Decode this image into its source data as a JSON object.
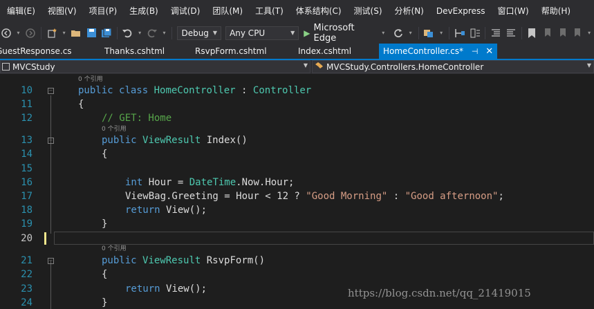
{
  "menu": [
    "编辑(E)",
    "视图(V)",
    "项目(P)",
    "生成(B)",
    "调试(D)",
    "团队(M)",
    "工具(T)",
    "体系结构(C)",
    "测试(S)",
    "分析(N)",
    "DevExpress",
    "窗口(W)",
    "帮助(H)"
  ],
  "toolbar": {
    "config": "Debug",
    "platform": "Any CPU",
    "run_label": "Microsoft Edge"
  },
  "tabs": [
    {
      "label": "GuestResponse.cs",
      "active": false
    },
    {
      "label": "Thanks.cshtml",
      "active": false
    },
    {
      "label": "RsvpForm.cshtml",
      "active": false
    },
    {
      "label": "Index.cshtml",
      "active": false
    },
    {
      "label": "HomeController.cs*",
      "active": true
    }
  ],
  "nav": {
    "project": "MVCStudy",
    "type": "MVCStudy.Controllers.HomeController"
  },
  "editor": {
    "ref0": "0 个引用",
    "ref1": "0 个引用",
    "ref2": "0 个引用",
    "lines": [
      {
        "n": "10",
        "segs": [
          [
            "kw",
            "public "
          ],
          [
            "kw",
            "class "
          ],
          [
            "ty",
            "HomeController"
          ],
          [
            "",
            "&nbsp;: "
          ],
          [
            "ty",
            "Controller"
          ]
        ]
      },
      {
        "n": "11",
        "segs": [
          [
            "",
            "{"
          ]
        ]
      },
      {
        "n": "12",
        "segs": [
          [
            "cm",
            "// GET: Home"
          ]
        ]
      },
      {
        "n": "13",
        "segs": [
          [
            "kw",
            "public "
          ],
          [
            "ty",
            "ViewResult"
          ],
          [
            "",
            "&nbsp;Index()"
          ]
        ]
      },
      {
        "n": "14",
        "segs": [
          [
            "",
            "{"
          ]
        ]
      },
      {
        "n": "15",
        "segs": []
      },
      {
        "n": "16",
        "segs": [
          [
            "kw",
            "int"
          ],
          [
            "",
            "&nbsp;Hour = "
          ],
          [
            "ty",
            "DateTime"
          ],
          [
            "",
            ".Now.Hour;"
          ]
        ]
      },
      {
        "n": "17",
        "segs": [
          [
            "",
            "ViewBag.Greeting = Hour &lt; 12 ? "
          ],
          [
            "str",
            "\"Good Morning\""
          ],
          [
            "",
            "&nbsp;: "
          ],
          [
            "str",
            "\"Good afternoon\""
          ],
          [
            "",
            ";"
          ]
        ]
      },
      {
        "n": "18",
        "segs": [
          [
            "kw",
            "return "
          ],
          [
            "",
            "View();"
          ]
        ]
      },
      {
        "n": "19",
        "segs": [
          [
            "",
            "}"
          ]
        ]
      },
      {
        "n": "20",
        "segs": []
      },
      {
        "n": "21",
        "segs": [
          [
            "kw",
            "public "
          ],
          [
            "ty",
            "ViewResult"
          ],
          [
            "",
            "&nbsp;RsvpForm()"
          ]
        ]
      },
      {
        "n": "22",
        "segs": [
          [
            "",
            "{"
          ]
        ]
      },
      {
        "n": "23",
        "segs": [
          [
            "kw",
            "return "
          ],
          [
            "",
            "View();"
          ]
        ]
      },
      {
        "n": "24",
        "segs": [
          [
            "",
            "}"
          ]
        ]
      }
    ]
  },
  "watermark": "https://blog.csdn.net/qq_21419015",
  "colors": {
    "accent": "#007acc",
    "keyword": "#569cd6",
    "type": "#4ec9b0",
    "string": "#d69d85",
    "comment": "#57a64a",
    "line_number": "#2b91af"
  },
  "icons": [
    "back-icon",
    "forward-icon",
    "new-project-icon",
    "open-icon",
    "save-icon",
    "save-all-icon",
    "undo-icon",
    "redo-icon",
    "play-icon",
    "refresh-icon",
    "browser-link-icon",
    "bookmark-icon",
    "comment-icon",
    "uncomment-icon"
  ]
}
